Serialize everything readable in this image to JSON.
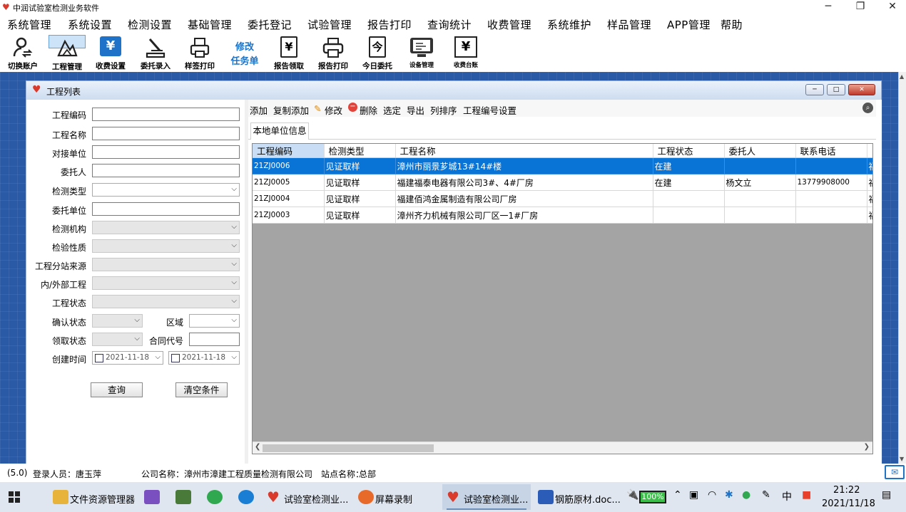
{
  "app": {
    "title": "中润试验室检测业务软件",
    "accent": "#0a74d6",
    "desktop_color": "#2a5aa6"
  },
  "window_controls": {
    "minimize": "─",
    "maximize": "❐",
    "close": "✕"
  },
  "menu": [
    "系统管理",
    "系统设置",
    "检测设置",
    "基础管理",
    "委托登记",
    "试验管理",
    "报告打印",
    "查询统计",
    "收费管理",
    "系统维护",
    "样品管理",
    "APP管理",
    "帮助"
  ],
  "toolbar": {
    "items": [
      {
        "label": "切换账户",
        "icon": "switch-user-icon"
      },
      {
        "label": "工程管理",
        "icon": "project-icon",
        "selected": true
      },
      {
        "label": "收费设置",
        "icon": "fee-setting-icon",
        "glyph": "¥"
      },
      {
        "label": "委托录入",
        "icon": "entrust-entry-icon"
      },
      {
        "label": "样签打印",
        "icon": "label-print-icon"
      },
      {
        "label": "修改任务单",
        "line1": "修改",
        "line2": "任务单",
        "icon": "task-edit-icon"
      },
      {
        "label": "报告领取",
        "icon": "report-receive-icon",
        "glyph": "¥"
      },
      {
        "label": "报告打印",
        "icon": "report-print-icon"
      },
      {
        "label": "今日委托",
        "icon": "today-entrust-icon",
        "glyph": "今"
      },
      {
        "label": "设备管理",
        "icon": "equipment-icon"
      },
      {
        "label": "收费台账",
        "icon": "fee-ledger-icon",
        "glyph": "¥"
      }
    ]
  },
  "window": {
    "title": "工程列表",
    "icon": "heart-icon",
    "min": "─",
    "max": "□",
    "close": "✕"
  },
  "form": {
    "labels": {
      "code": "工程编码",
      "name": "工程名称",
      "contact_unit": "对接单位",
      "client": "委托人",
      "test_type": "检测类型",
      "client_unit": "委托单位",
      "agency": "检测机构",
      "nature": "检验性质",
      "branch": "工程分站来源",
      "inout": "内/外部工程",
      "status": "工程状态",
      "confirm": "确认状态",
      "area": "区域",
      "receive": "领取状态",
      "contract": "合同代号",
      "created": "创建时间"
    },
    "values": {
      "code": "",
      "name": "",
      "contact_unit": "",
      "client": "",
      "client_unit": "",
      "contract": ""
    },
    "date_from": "2021-11-18",
    "date_to": "2021-11-18",
    "query_button": "查询",
    "clear_button": "清空条件"
  },
  "grid_toolbar": {
    "add": "添加",
    "copy_add": "复制添加",
    "edit": "修改",
    "delete": "删除",
    "select": "选定",
    "export": "导出",
    "sort": "列排序",
    "code_setting": "工程编号设置"
  },
  "tab": "本地单位信息",
  "table": {
    "columns": [
      "工程编码",
      "检测类型",
      "工程名称",
      "工程状态",
      "委托人",
      "联系电话",
      ""
    ],
    "rows": [
      {
        "code": "21ZJ0006",
        "type": "见证取样",
        "name": "漳州市丽景芗城13#14#楼",
        "status": "在建",
        "client": "",
        "phone": "",
        "extra": "福",
        "selected": true
      },
      {
        "code": "21ZJ0005",
        "type": "见证取样",
        "name": "福建福泰电器有限公司3#、4#厂房",
        "status": "在建",
        "client": "杨文立",
        "phone": "13779908000",
        "extra": "福"
      },
      {
        "code": "21ZJ0004",
        "type": "见证取样",
        "name": "福建佰鸿金属制造有限公司厂房",
        "status": "",
        "client": "",
        "phone": "",
        "extra": "福"
      },
      {
        "code": "21ZJ0003",
        "type": "见证取样",
        "name": "漳州齐力机械有限公司厂区一1#厂房",
        "status": "",
        "client": "",
        "phone": "",
        "extra": "福"
      }
    ]
  },
  "status_bar": {
    "version": "(5.0)",
    "user_label": "登录人员：",
    "user": "唐玉萍",
    "company_label": "公司名称：",
    "company": "漳州市漳建工程质量检测有限公司",
    "station_label": "站点名称：",
    "station": "总部"
  },
  "taskbar": {
    "items": [
      {
        "label": "文件资源管理器",
        "icon": "folder-icon",
        "color": "#e8b33a"
      },
      {
        "label": "",
        "icon": "visual-studio-icon",
        "color": "#7a4fbf"
      },
      {
        "label": "",
        "icon": "tools-icon",
        "color": "#4a7a3a"
      },
      {
        "label": "",
        "icon": "green-app-icon",
        "color": "#2fa84f"
      },
      {
        "label": "",
        "icon": "edge-icon",
        "color": "#1a7fd4"
      },
      {
        "label": "试验室检测业...",
        "icon": "heart-app-icon",
        "color": "#d93a2b"
      },
      {
        "label": "屏幕录制",
        "icon": "screen-record-icon",
        "color": "#e86a2a"
      },
      {
        "label": "试验室检测业...",
        "icon": "heart-app-icon",
        "color": "#d93a2b",
        "active": true
      },
      {
        "label": "钢筋原材.doc...",
        "icon": "word-icon",
        "color": "#2b5cb8"
      }
    ],
    "battery": "100%",
    "ime": "中",
    "time": "21:22",
    "date": "2021/11/18"
  }
}
